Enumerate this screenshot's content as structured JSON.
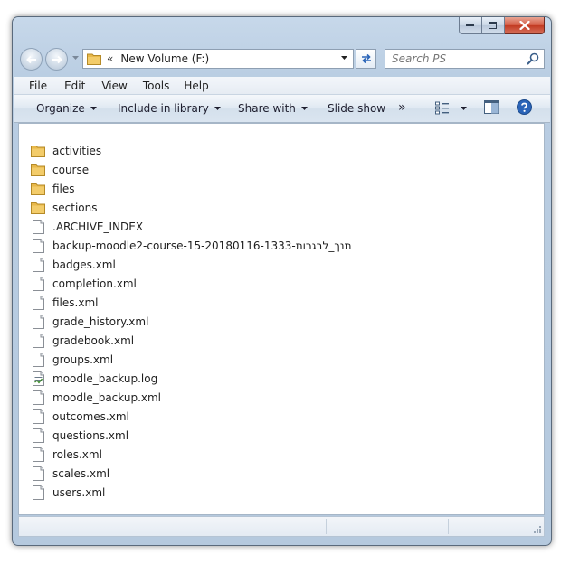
{
  "window": {
    "caption_buttons": [
      "minimize",
      "maximize",
      "close"
    ]
  },
  "address_bar": {
    "chevrons": "«",
    "path": "New Volume (F:)",
    "folder_icon": "folder-icon"
  },
  "search": {
    "placeholder": "Search PS"
  },
  "menu": {
    "items": [
      "File",
      "Edit",
      "View",
      "Tools",
      "Help"
    ]
  },
  "commands": {
    "organize": "Organize",
    "include_in_library": "Include in library",
    "share_with": "Share with",
    "slide_show": "Slide show",
    "more": "»"
  },
  "colors": {
    "folder": "#e8b84a",
    "accent_blue": "#2a64b8",
    "close_red": "#c23a22"
  },
  "files": [
    {
      "name": "activities",
      "type": "folder"
    },
    {
      "name": "course",
      "type": "folder"
    },
    {
      "name": "files",
      "type": "folder"
    },
    {
      "name": "sections",
      "type": "folder"
    },
    {
      "name": ".ARCHIVE_INDEX",
      "type": "file"
    },
    {
      "name": "backup-moodle2-course-15-20180116-1333-תנך_לבגרות",
      "type": "file"
    },
    {
      "name": "badges.xml",
      "type": "file"
    },
    {
      "name": "completion.xml",
      "type": "file"
    },
    {
      "name": "files.xml",
      "type": "file"
    },
    {
      "name": "grade_history.xml",
      "type": "file"
    },
    {
      "name": "gradebook.xml",
      "type": "file"
    },
    {
      "name": "groups.xml",
      "type": "file"
    },
    {
      "name": "moodle_backup.log",
      "type": "log"
    },
    {
      "name": "moodle_backup.xml",
      "type": "file"
    },
    {
      "name": "outcomes.xml",
      "type": "file"
    },
    {
      "name": "questions.xml",
      "type": "file"
    },
    {
      "name": "roles.xml",
      "type": "file"
    },
    {
      "name": "scales.xml",
      "type": "file"
    },
    {
      "name": "users.xml",
      "type": "file"
    }
  ]
}
